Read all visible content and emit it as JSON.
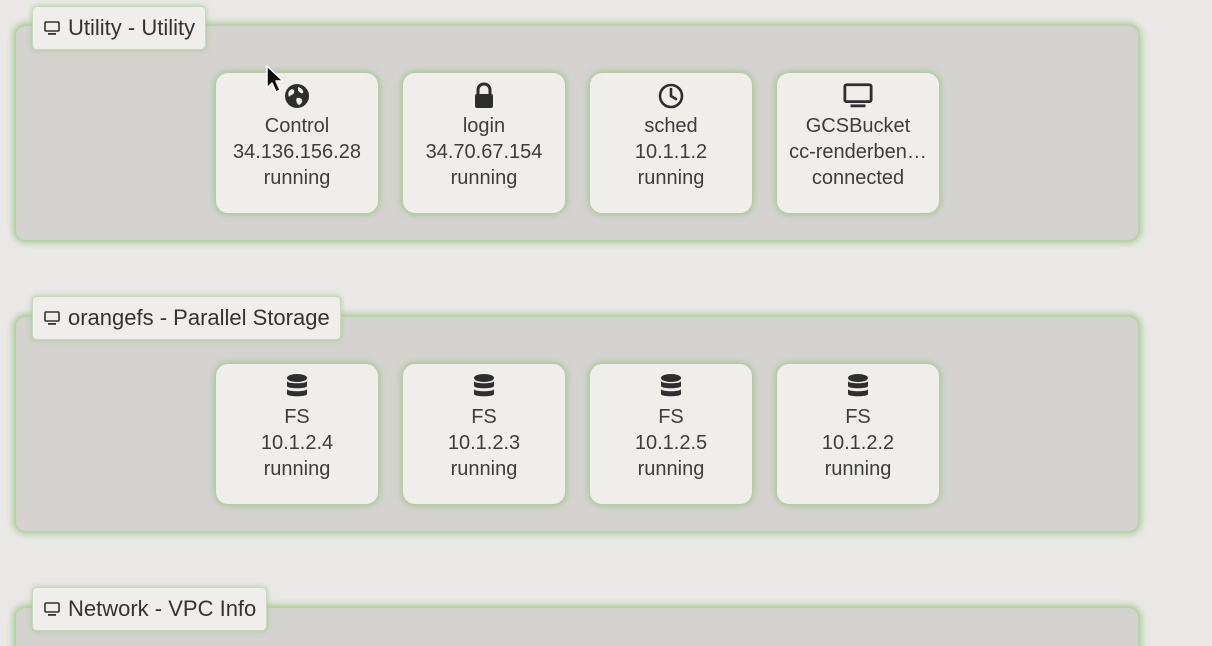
{
  "groups": [
    {
      "label": "Utility - Utility",
      "icon": "monitor-icon",
      "cards": [
        {
          "icon": "globe-icon",
          "name": "Control",
          "address": "34.136.156.28",
          "status": "running"
        },
        {
          "icon": "lock-icon",
          "name": "login",
          "address": "34.70.67.154",
          "status": "running"
        },
        {
          "icon": "clock-icon",
          "name": "sched",
          "address": "10.1.1.2",
          "status": "running"
        },
        {
          "icon": "monitor-icon",
          "name": "GCSBucket",
          "address": "cc-renderben…",
          "status": "connected"
        }
      ]
    },
    {
      "label": "orangefs - Parallel Storage",
      "icon": "monitor-icon",
      "cards": [
        {
          "icon": "database-icon",
          "name": "FS",
          "address": "10.1.2.4",
          "status": "running"
        },
        {
          "icon": "database-icon",
          "name": "FS",
          "address": "10.1.2.3",
          "status": "running"
        },
        {
          "icon": "database-icon",
          "name": "FS",
          "address": "10.1.2.5",
          "status": "running"
        },
        {
          "icon": "database-icon",
          "name": "FS",
          "address": "10.1.2.2",
          "status": "running"
        }
      ]
    },
    {
      "label": "Network - VPC Info",
      "icon": "monitor-icon",
      "cards": []
    }
  ],
  "colors": {
    "background": "#e9e8e6",
    "group_fill": "#d4d3d0",
    "card_fill": "#efeeeb",
    "glow": "#8cbe6e",
    "text": "#3d3d3d"
  }
}
